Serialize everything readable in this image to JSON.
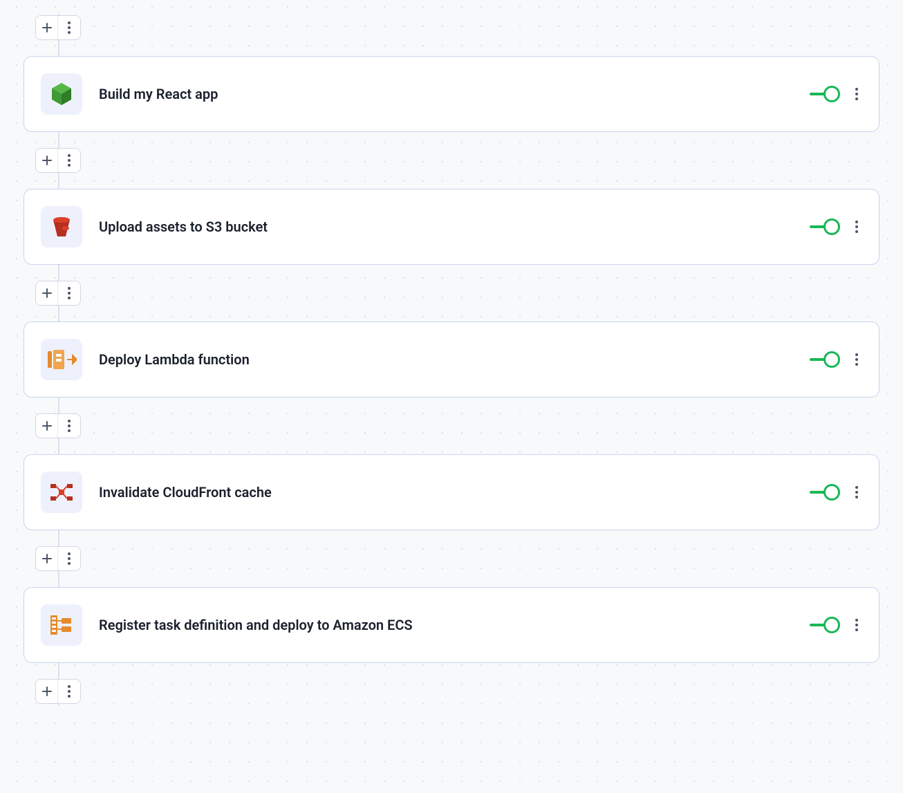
{
  "steps": [
    {
      "title": "Build my React app",
      "enabled": true,
      "icon": "node-hexagon"
    },
    {
      "title": "Upload assets to S3 bucket",
      "enabled": true,
      "icon": "s3-bucket"
    },
    {
      "title": "Deploy Lambda function",
      "enabled": true,
      "icon": "lambda"
    },
    {
      "title": "Invalidate CloudFront cache",
      "enabled": true,
      "icon": "cloudfront"
    },
    {
      "title": "Register task definition and deploy to Amazon ECS",
      "enabled": true,
      "icon": "ecs"
    }
  ],
  "colors": {
    "toggle_on": "#17b756",
    "node_green": "#3f9c35",
    "aws_red": "#d9402b",
    "aws_orange": "#e68a2e"
  }
}
